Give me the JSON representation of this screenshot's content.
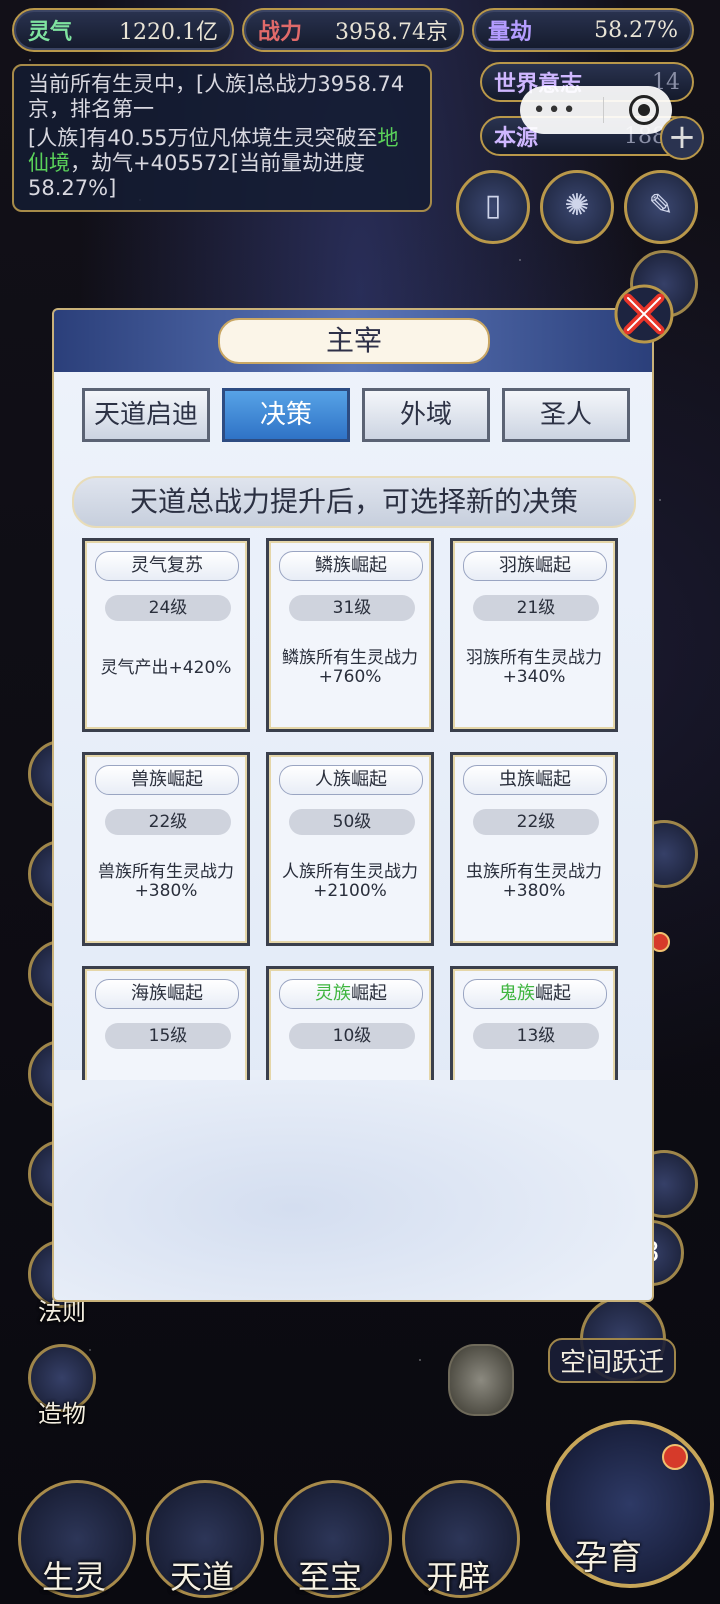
{
  "top_stats": {
    "lingqi": {
      "label": "灵气",
      "value": "1220.1亿",
      "color": "#7fe3a0"
    },
    "zhanli": {
      "label": "战力",
      "value": "3958.74京",
      "color": "#e06a6a"
    },
    "liangjie": {
      "label": "量劫",
      "value": "58.27%",
      "color": "#b49cff"
    }
  },
  "right_stats": {
    "shijie": {
      "label": "世界意志",
      "value": "14"
    },
    "benyuan": {
      "label": "本源",
      "value": "1886"
    }
  },
  "info": {
    "line1": "当前所有生灵中，[人族]总战力3958.74京，排名第一",
    "line2_prefix": "[人族]有40.55万位凡体境生灵突破至",
    "line2_green": "地仙境",
    "line2_suffix": "，劫气+405572[当前量劫进度58.27%]"
  },
  "side_labels": {
    "fa_ze": "法则",
    "zao_wu": "造物",
    "kong_jian": "空间跃迁",
    "badge_3": "3"
  },
  "bottom_nav": [
    "生灵",
    "天道",
    "至宝",
    "开辟"
  ],
  "big_button": "孕育",
  "dialog": {
    "title": "主宰",
    "tabs": [
      "天道启迪",
      "决策",
      "外域",
      "圣人"
    ],
    "active_tab": "决策",
    "banner": "天道总战力提升后，可选择新的决策",
    "cards": [
      {
        "name": "灵气复苏",
        "level": "24级",
        "desc": "灵气产出+420%"
      },
      {
        "name": "鳞族崛起",
        "level": "31级",
        "desc": "鳞族所有生灵战力+760%"
      },
      {
        "name": "羽族崛起",
        "level": "21级",
        "desc": "羽族所有生灵战力+340%"
      },
      {
        "name": "兽族崛起",
        "level": "22级",
        "desc": "兽族所有生灵战力+380%"
      },
      {
        "name": "人族崛起",
        "level": "50级",
        "desc": "人族所有生灵战力+2100%"
      },
      {
        "name": "虫族崛起",
        "level": "22级",
        "desc": "虫族所有生灵战力+380%"
      },
      {
        "name": "海族崛起",
        "level": "15级",
        "desc": ""
      },
      {
        "name_green": "灵族",
        "name_rest": "崛起",
        "level": "10级",
        "desc": ""
      },
      {
        "name_green": "鬼族",
        "name_rest": "崛起",
        "level": "13级",
        "desc": ""
      }
    ]
  }
}
